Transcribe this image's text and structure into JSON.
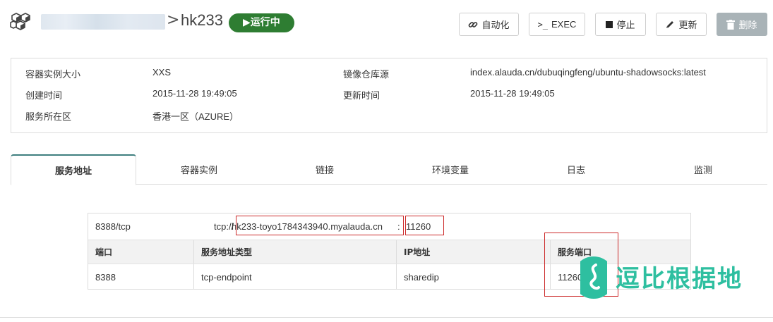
{
  "header": {
    "breadcrumb_separator": ">",
    "app_name": "hk233",
    "status": "▶运行中",
    "actions": {
      "automate": "自动化",
      "exec": "EXEC",
      "stop": "停止",
      "update": "更新",
      "delete": "删除"
    }
  },
  "info": {
    "size_label": "容器实例大小",
    "size_value": "XXS",
    "created_label": "创建时间",
    "created_value": "2015-11-28 19:49:05",
    "region_label": "服务所在区",
    "region_value": "香港一区（AZURE）",
    "image_label": "镜像仓库源",
    "image_value": "index.alauda.cn/dubuqingfeng/ubuntu-shadowsocks:latest",
    "updated_label": "更新时间",
    "updated_value": "2015-11-28 19:49:05"
  },
  "tabs": [
    "服务地址",
    "容器实例",
    "链接",
    "环境变量",
    "日志",
    "监测"
  ],
  "endpoint": {
    "protocol_port": "8388/tcp",
    "scheme": "tcp://",
    "host": "hk233-toyo1784343940.myalauda.cn",
    "colon": ":",
    "service_port": "11260",
    "columns": [
      "端口",
      "服务地址类型",
      "IP地址",
      "服务端口"
    ],
    "row": [
      "8388",
      "tcp-endpoint",
      "sharedip",
      "11260"
    ]
  },
  "watermark": {
    "text": "逗比根据地"
  },
  "colors": {
    "status_green": "#2e7d32",
    "highlight_red": "#cc2a2a",
    "watermark_teal": "#2ebfa0",
    "disabled_button": "#a9b3b7"
  }
}
